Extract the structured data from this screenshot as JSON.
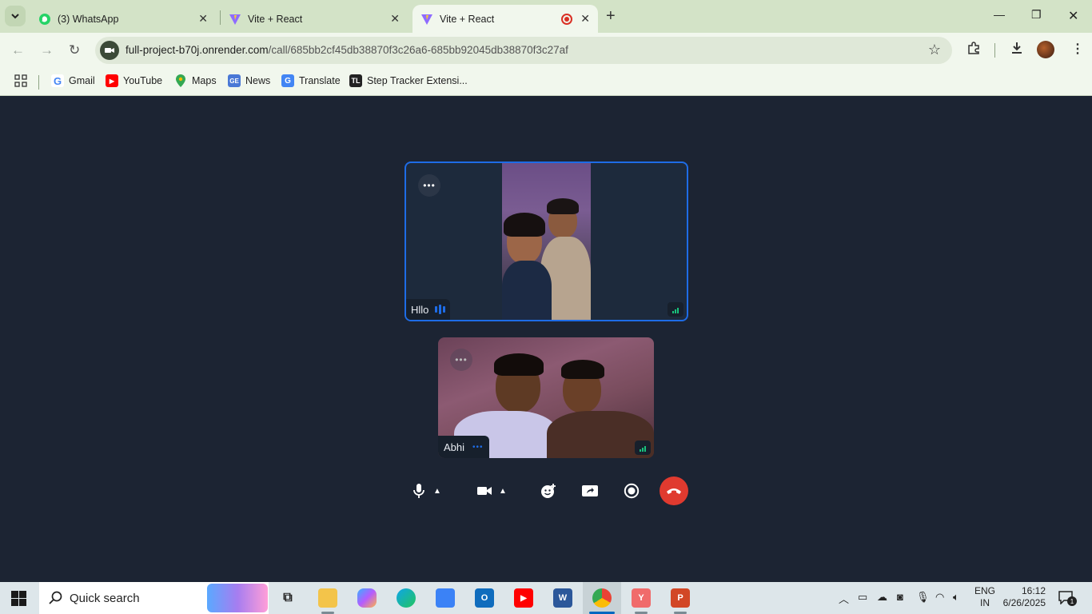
{
  "browser": {
    "tabs": [
      {
        "label": "(3) WhatsApp",
        "icon": "whatsapp-icon",
        "active": false
      },
      {
        "label": "Vite + React",
        "icon": "vite-icon",
        "active": false
      },
      {
        "label": "Vite + React",
        "icon": "vite-icon",
        "active": true,
        "recording": true
      }
    ],
    "url_host": "full-project-b70j.onrender.com",
    "url_path": "/call/685bb2cf45db38870f3c26a6-685bb92045db38870f3c27af",
    "bookmarks": [
      {
        "label": "Gmail",
        "icon": "gmail-icon"
      },
      {
        "label": "YouTube",
        "icon": "youtube-icon"
      },
      {
        "label": "Maps",
        "icon": "maps-icon"
      },
      {
        "label": "News",
        "icon": "news-icon"
      },
      {
        "label": "Translate",
        "icon": "translate-icon"
      },
      {
        "label": "Step Tracker Extensi...",
        "icon": "step-tracker-icon"
      }
    ]
  },
  "call": {
    "participants": [
      {
        "name": "Hllo",
        "speaking": true,
        "signal": "good"
      },
      {
        "name": "Abhi",
        "speaking": false,
        "signal": "good"
      }
    ],
    "controls": [
      "mic-button",
      "mic-options-button",
      "camera-button",
      "camera-options-button",
      "reaction-button",
      "share-screen-button",
      "record-button",
      "hangup-button"
    ],
    "colors": {
      "accent": "#1e6ce6",
      "hangup": "#e03a2f",
      "signal": "#19c37d",
      "background": "#1c2433"
    }
  },
  "taskbar": {
    "search_label": "Quick search",
    "lang_top": "ENG",
    "lang_bottom": "IN",
    "time": "16:12",
    "date": "6/26/2025",
    "notifications": "1"
  }
}
